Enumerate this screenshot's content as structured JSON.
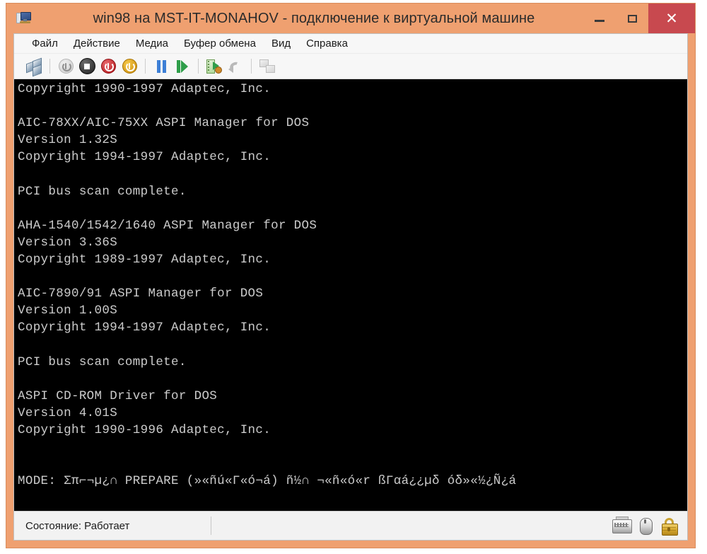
{
  "window": {
    "title": "win98 на MST-IT-MONAHOV - подключение к виртуальной машине",
    "icon": "virtual-machine-icon",
    "controls": {
      "minimize": "—",
      "maximize": "□",
      "close": "✕"
    },
    "frame_color": "#efa070",
    "close_color": "#c8494f"
  },
  "menubar": {
    "items": [
      {
        "label": "Файл"
      },
      {
        "label": "Действие"
      },
      {
        "label": "Медиа"
      },
      {
        "label": "Буфер обмена"
      },
      {
        "label": "Вид"
      },
      {
        "label": "Справка"
      }
    ]
  },
  "toolbar": {
    "buttons": [
      {
        "name": "connect-icon",
        "kind": "cubes"
      },
      {
        "name": "power-off-icon",
        "kind": "power-off"
      },
      {
        "name": "shutdown-icon",
        "kind": "stop-circle"
      },
      {
        "name": "turn-off-icon",
        "kind": "power-red"
      },
      {
        "name": "start-icon",
        "kind": "power-amber"
      },
      {
        "name": "pause-icon",
        "kind": "pause"
      },
      {
        "name": "resume-icon",
        "kind": "play"
      },
      {
        "name": "checkpoint-icon",
        "kind": "snapshot"
      },
      {
        "name": "revert-icon",
        "kind": "undo"
      },
      {
        "name": "apply-icon",
        "kind": "revert"
      }
    ]
  },
  "terminal": {
    "background": "#000000",
    "foreground": "#cccccc",
    "lines": [
      "Copyright 1990-1997 Adaptec, Inc.",
      "",
      "AIC-78XX/AIC-75XX ASPI Manager for DOS",
      "Version 1.32S",
      "Copyright 1994-1997 Adaptec, Inc.",
      "",
      "PCI bus scan complete.",
      "",
      "AHA-1540/1542/1640 ASPI Manager for DOS",
      "Version 3.36S",
      "Copyright 1989-1997 Adaptec, Inc.",
      "",
      "AIC-7890/91 ASPI Manager for DOS",
      "Version 1.00S",
      "Copyright 1994-1997 Adaptec, Inc.",
      "",
      "PCI bus scan complete.",
      "",
      "ASPI CD-ROM Driver for DOS",
      "Version 4.01S",
      "Copyright 1990-1996 Adaptec, Inc.",
      "",
      "",
      "MODE: Σπ⌐¬µ¿∩ PREPARE (»«ñú«Γ«ó¬á) ñ½∩ ¬«ñ«ó«r ßΓαá¿¿µδ óδ»«½¿Ñ¿á"
    ]
  },
  "statusbar": {
    "text": "Состояние: Работает",
    "icons": [
      {
        "name": "keyboard-icon"
      },
      {
        "name": "mouse-icon"
      },
      {
        "name": "lock-icon"
      }
    ]
  }
}
